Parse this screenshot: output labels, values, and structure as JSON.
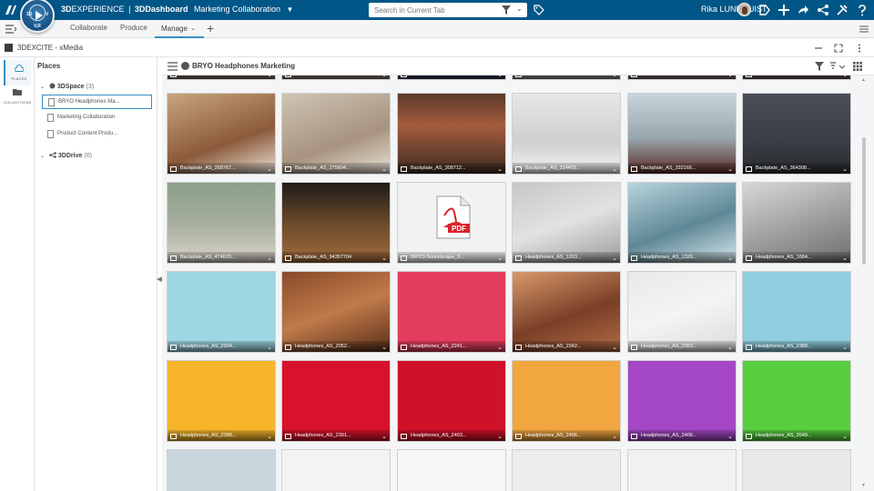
{
  "topbar": {
    "brand_bold": "3D",
    "brand_rest": "EXPERIENCE",
    "brand_sep": "|",
    "brand_dash": "3DDashboard",
    "app_name": "Marketing Collaboration",
    "search_placeholder": "Search in Current Tab",
    "user_name": "Rika LUNDQUIST",
    "compass_3d": "3D",
    "compass_v": "V",
    "compass_va": "V,R"
  },
  "tabs": [
    {
      "label": "Collaborate",
      "active": false
    },
    {
      "label": "Produce",
      "active": false
    },
    {
      "label": "Manage",
      "active": true
    }
  ],
  "app": {
    "title": "3DEXCITE - xMedia"
  },
  "leftnav": {
    "places": "PLACES",
    "collections": "COLLECTIONS"
  },
  "places": {
    "title": "Places",
    "space_name": "3DSpace",
    "space_count": "(3)",
    "space_items": [
      "BRYO Headphones Ma...",
      "Marketing Collaboration",
      "Product Content Produ..."
    ],
    "drive_name": "3DDrive",
    "drive_count": "(0)"
  },
  "content": {
    "title": "BRYO Headphones Marketing"
  },
  "tiles": [
    {
      "caption": "Backplate_AS_269473...",
      "row": 0,
      "col": 0
    },
    {
      "caption": "Backplate_AS_217882...",
      "row": 0,
      "col": 1
    },
    {
      "caption": "Backplate_AS_218199...",
      "row": 0,
      "col": 2
    },
    {
      "caption": "Backplate_AS_218629...",
      "row": 0,
      "col": 3
    },
    {
      "caption": "Backplate_AS_242971...",
      "row": 0,
      "col": 4
    },
    {
      "caption": "Backplate_AS_260924...",
      "row": 0,
      "col": 5
    },
    {
      "caption": "Backplate_AS_268767...",
      "row": 1,
      "col": 0
    },
    {
      "caption": "Backplate_AS_275604...",
      "row": 1,
      "col": 1
    },
    {
      "caption": "Backplate_AS_308712...",
      "row": 1,
      "col": 2
    },
    {
      "caption": "Backplate_AS_314403...",
      "row": 1,
      "col": 3
    },
    {
      "caption": "Backplate_AS_332166...",
      "row": 1,
      "col": 4
    },
    {
      "caption": "Backplate_AS_364308...",
      "row": 1,
      "col": 5
    },
    {
      "caption": "Backplate_AS_474670...",
      "row": 2,
      "col": 0
    },
    {
      "caption": "Backplate_AS_94357704",
      "row": 2,
      "col": 1
    },
    {
      "caption": "BRYO-Soundscape_S...",
      "row": 2,
      "col": 2,
      "pdf": true
    },
    {
      "caption": "Headphones_AS_1203...",
      "row": 2,
      "col": 3
    },
    {
      "caption": "Headphones_AS_1326...",
      "row": 2,
      "col": 4
    },
    {
      "caption": "Headphones_AS_1684...",
      "row": 2,
      "col": 5
    },
    {
      "caption": "Headphones_AS_2004...",
      "row": 3,
      "col": 0
    },
    {
      "caption": "Headphones_AS_2052...",
      "row": 3,
      "col": 1
    },
    {
      "caption": "Headphones_AS_2241...",
      "row": 3,
      "col": 2
    },
    {
      "caption": "Headphones_AS_2342...",
      "row": 3,
      "col": 3
    },
    {
      "caption": "Headphones_AS_2362...",
      "row": 3,
      "col": 4
    },
    {
      "caption": "Headphones_AS_2388...",
      "row": 3,
      "col": 5
    },
    {
      "caption": "Headphones_AS_2388...",
      "row": 4,
      "col": 0
    },
    {
      "caption": "Headphones_AS_2391...",
      "row": 4,
      "col": 1
    },
    {
      "caption": "Headphones_AS_2403...",
      "row": 4,
      "col": 2
    },
    {
      "caption": "Headphones_AS_2406...",
      "row": 4,
      "col": 3
    },
    {
      "caption": "Headphones_AS_2406...",
      "row": 4,
      "col": 4
    },
    {
      "caption": "Headphones_AS_2649...",
      "row": 4,
      "col": 5
    },
    {
      "caption": "",
      "row": 5,
      "col": 0
    },
    {
      "caption": "",
      "row": 5,
      "col": 1
    },
    {
      "caption": "",
      "row": 5,
      "col": 2
    },
    {
      "caption": "",
      "row": 5,
      "col": 3
    },
    {
      "caption": "",
      "row": 5,
      "col": 4
    },
    {
      "caption": "",
      "row": 5,
      "col": 5
    }
  ],
  "pdf_label": "PDF",
  "colors": {
    "topbar": "#005686",
    "accent": "#368ec4"
  }
}
